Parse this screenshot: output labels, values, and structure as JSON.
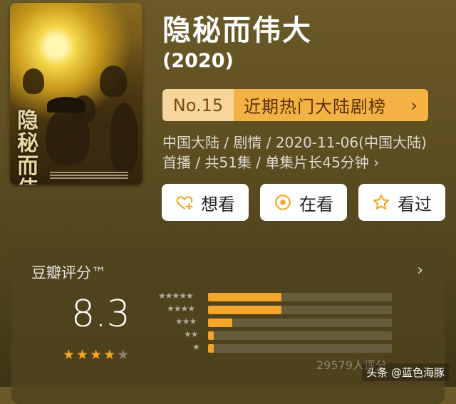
{
  "show": {
    "title": "隐秘而伟大",
    "year": "(2020)",
    "poster_text": "隐秘而伟大"
  },
  "ranking": {
    "number": "No.15",
    "name": "近期热门大陆剧榜",
    "chevron": "›"
  },
  "meta": {
    "text": "中国大陆 / 剧情 / 2020-11-06(中国大陆)首播 / 共51集 / 单集片长45分钟 ›"
  },
  "actions": [
    {
      "label": "想看",
      "icon": "heart-plus-icon"
    },
    {
      "label": "在看",
      "icon": "target-icon"
    },
    {
      "label": "看过",
      "icon": "star-outline-icon"
    }
  ],
  "rating": {
    "title": "豆瓣评分™",
    "chevron": "›",
    "score": "8.3",
    "stars_filled": 4,
    "stars_total": 5,
    "votes": "29579人评分",
    "distribution": [
      {
        "stars": "★★★★★",
        "percent": 40
      },
      {
        "stars": "★★★★",
        "percent": 40
      },
      {
        "stars": "★★★",
        "percent": 13
      },
      {
        "stars": "★★",
        "percent": 3
      },
      {
        "stars": "★",
        "percent": 3
      }
    ]
  },
  "watermark": "头条 @蓝色海豚",
  "colors": {
    "accent": "#f4a62a",
    "rank_light": "#f6d69a",
    "rank_dark": "#f4b244"
  }
}
